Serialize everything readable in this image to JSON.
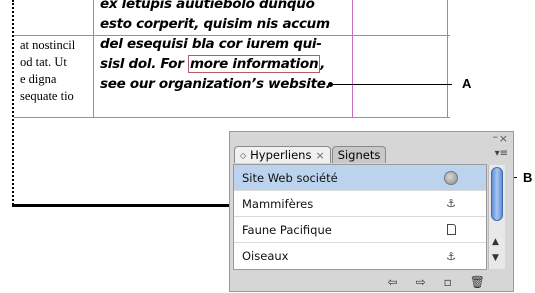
{
  "document": {
    "left_lines": [
      "at nostincil",
      "od tat. Ut",
      "e digna",
      "sequate tio"
    ],
    "bold_lines": [
      "ex letupis auutiebolo dunquo",
      "esto corperit, quisim nis accum",
      "del esequisi bla cor iurem qui-",
      "sisl dol. For ",
      "more information",
      ",",
      "see our organization’s website."
    ]
  },
  "callouts": {
    "a": "A",
    "b": "B"
  },
  "panel": {
    "tabs": [
      {
        "label": "Hyperliens",
        "close": "×",
        "active": true
      },
      {
        "label": "Signets",
        "active": false
      }
    ],
    "window_minimize": "–",
    "window_close": "×",
    "menu_icon": "▾≡",
    "items": [
      {
        "label": "Site Web société",
        "icon": "globe-icon",
        "selected": true
      },
      {
        "label": "Mammifères",
        "icon": "anchor-icon",
        "glyph": "⚓"
      },
      {
        "label": "Faune Pacifique",
        "icon": "page-icon"
      },
      {
        "label": "Oiseaux",
        "icon": "anchor-icon",
        "glyph": "⚓"
      }
    ],
    "scroll_up": "▲",
    "scroll_down": "▼",
    "footer": {
      "back": "⇦",
      "forward": "⇨",
      "new": "▫",
      "delete": "🗑"
    }
  }
}
